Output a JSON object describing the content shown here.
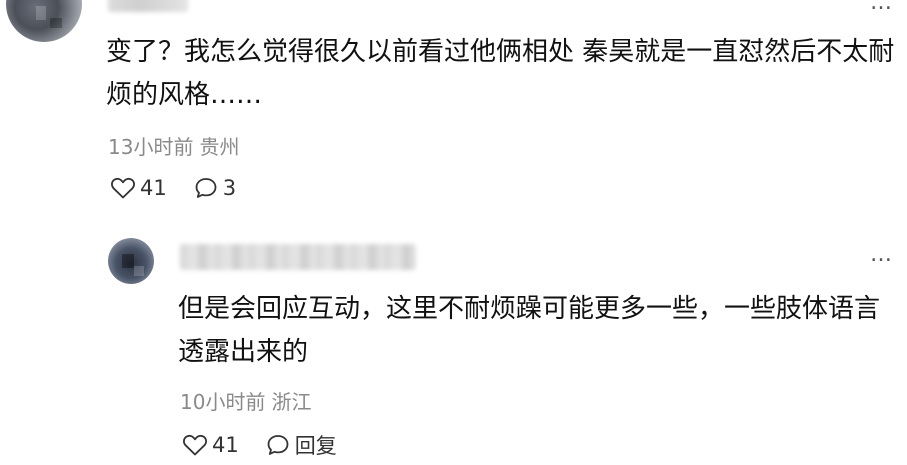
{
  "comment": {
    "text": "变了？我怎么觉得很久以前看过他俩相处 秦昊就是一直怼然后不太耐烦的风格……",
    "time": "13小时前",
    "location": "贵州",
    "likes": "41",
    "replies": "3",
    "more_label": "…"
  },
  "reply": {
    "text": "但是会回应互动，这里不耐烦躁可能更多一些，一些肢体语言透露出来的",
    "time": "10小时前",
    "location": "浙江",
    "likes": "41",
    "reply_label": "回复",
    "more_label": "…"
  },
  "icons": {
    "like": "heart-outline-icon",
    "comment": "speech-bubble-icon",
    "more": "more-dots-icon"
  }
}
